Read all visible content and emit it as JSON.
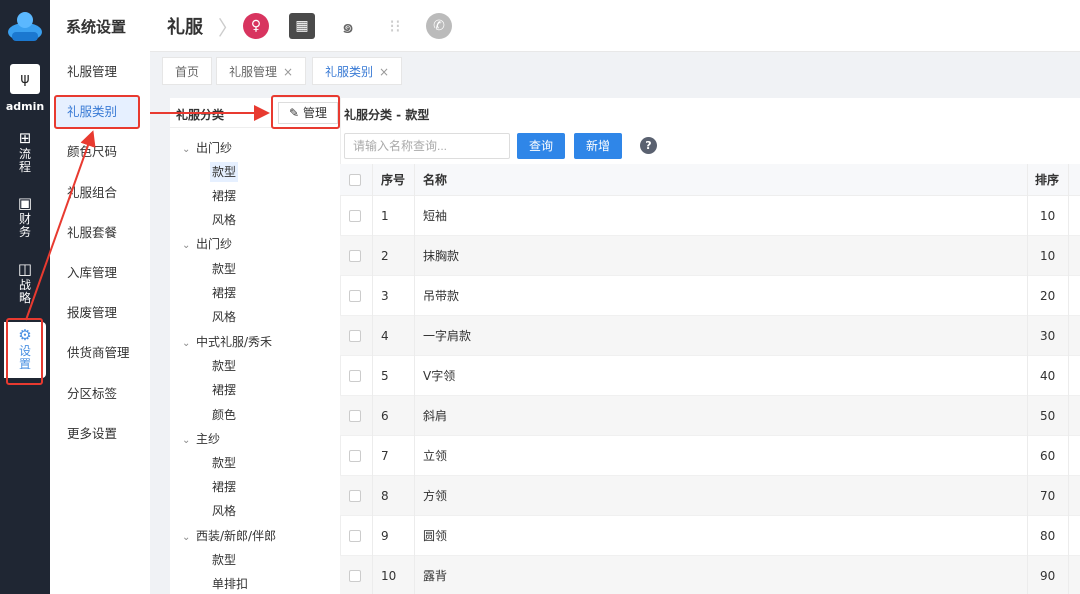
{
  "rail": {
    "admin_label": "admin",
    "items": [
      {
        "label": "流程",
        "icon": "flow-icon"
      },
      {
        "label": "财务",
        "icon": "wallet-icon"
      },
      {
        "label": "战略",
        "icon": "briefcase-icon"
      },
      {
        "label": "设置",
        "icon": "gear-icon"
      }
    ]
  },
  "sidebar": {
    "title": "系统设置",
    "items": [
      {
        "label": "礼服管理"
      },
      {
        "label": "礼服类别"
      },
      {
        "label": "颜色尺码"
      },
      {
        "label": "礼服组合"
      },
      {
        "label": "礼服套餐"
      },
      {
        "label": "入库管理"
      },
      {
        "label": "报废管理"
      },
      {
        "label": "供货商管理"
      },
      {
        "label": "分区标签"
      },
      {
        "label": "更多设置"
      }
    ]
  },
  "header": {
    "title": "礼服"
  },
  "tabs": [
    {
      "label": "首页"
    },
    {
      "label": "礼服管理",
      "close": "×"
    },
    {
      "label": "礼服类别",
      "close": "×"
    }
  ],
  "tree": {
    "title": "礼服分类",
    "manage_label": "管理",
    "groups": [
      {
        "label": "出门纱",
        "children": [
          "款型",
          "裙摆",
          "风格"
        ]
      },
      {
        "label": "出门纱",
        "children": [
          "款型",
          "裙摆",
          "风格"
        ]
      },
      {
        "label": "中式礼服/秀禾",
        "children": [
          "款型",
          "裙摆",
          "颜色"
        ]
      },
      {
        "label": "主纱",
        "children": [
          "款型",
          "裙摆",
          "风格"
        ]
      },
      {
        "label": "西装/新郎/伴郎",
        "children": [
          "款型",
          "单排扣"
        ]
      }
    ]
  },
  "main": {
    "heading": "礼服分类 - 款型",
    "search_placeholder": "请输入名称查询...",
    "query_label": "查询",
    "add_label": "新增",
    "help_label": "?",
    "columns": {
      "index": "序号",
      "name": "名称",
      "sort": "排序"
    },
    "rows": [
      {
        "index": "1",
        "name": "短袖",
        "sort": "10"
      },
      {
        "index": "2",
        "name": "抹胸款",
        "sort": "10"
      },
      {
        "index": "3",
        "name": "吊带款",
        "sort": "20"
      },
      {
        "index": "4",
        "name": "一字肩款",
        "sort": "30"
      },
      {
        "index": "5",
        "name": "V字领",
        "sort": "40"
      },
      {
        "index": "6",
        "name": "斜肩",
        "sort": "50"
      },
      {
        "index": "7",
        "name": "立领",
        "sort": "60"
      },
      {
        "index": "8",
        "name": "方领",
        "sort": "70"
      },
      {
        "index": "9",
        "name": "圆领",
        "sort": "80"
      },
      {
        "index": "10",
        "name": "露背",
        "sort": "90"
      }
    ]
  },
  "colors": {
    "accent": "#2f86e8",
    "rail_bg": "#1f2633",
    "annotation": "#e83a30"
  }
}
